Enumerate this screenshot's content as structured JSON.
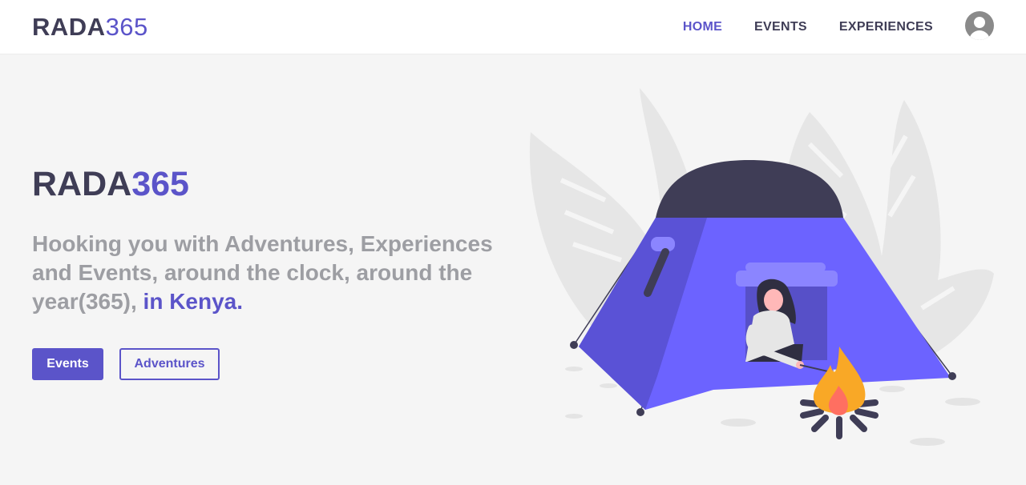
{
  "navbar": {
    "brand_part1": "RADA",
    "brand_part2": "365",
    "links": [
      "HOME",
      "EVENTS",
      "EXPERIENCES"
    ],
    "active_link": "HOME",
    "profile_icon": "user-circle-icon"
  },
  "hero": {
    "title_part1": "RADA",
    "title_part2": "365",
    "tagline_main": "Hooking you with Adventures, Experiences and Events, around the clock, around the year(365),",
    "tagline_accent": "in Kenya.",
    "primary_button": "Events",
    "secondary_button": "Adventures",
    "illustration": "camping-tent-campfire-illustration"
  },
  "colors": {
    "accent": "#5b54c9",
    "dark": "#3f3d56",
    "muted_text": "#9d9ea3",
    "tent": "#6c63ff",
    "background": "#f5f5f5"
  }
}
